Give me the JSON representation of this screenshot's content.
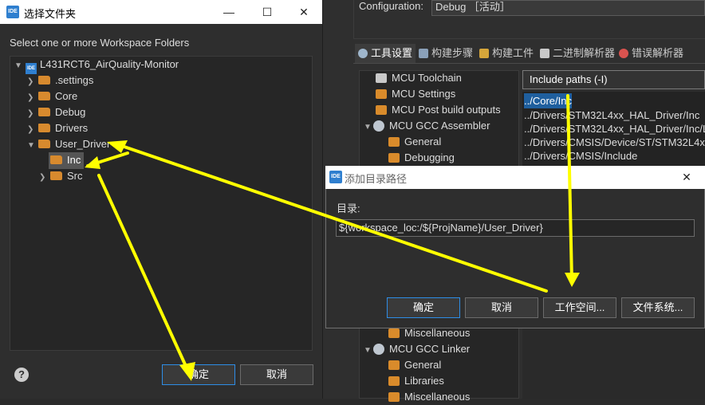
{
  "background_window": {
    "config_label": "Configuration:",
    "config_value": "Debug ［活动］",
    "tabs": [
      {
        "label": "工具设置",
        "icon": "gear-icon",
        "active": true
      },
      {
        "label": "构建步骤",
        "icon": "build-steps-icon",
        "active": false
      },
      {
        "label": "构建工件",
        "icon": "trophy-icon",
        "active": false
      },
      {
        "label": "二进制解析器",
        "icon": "binary-icon",
        "active": false
      },
      {
        "label": "错误解析器",
        "icon": "error-icon",
        "active": false
      }
    ],
    "tree": [
      {
        "label": "MCU Toolchain",
        "icon": "toolchain-icon",
        "indent": 0
      },
      {
        "label": "MCU Settings",
        "icon": "settings-icon",
        "indent": 0
      },
      {
        "label": "MCU Post build outputs",
        "icon": "settings-icon",
        "indent": 0
      },
      {
        "label": "MCU GCC Assembler",
        "icon": "gear-icon",
        "indent": 0,
        "expanded": true
      },
      {
        "label": "General",
        "icon": "settings-icon",
        "indent": 1
      },
      {
        "label": "Debugging",
        "icon": "settings-icon",
        "indent": 1
      },
      {
        "label": "Miscellaneous",
        "icon": "settings-icon",
        "indent": 1
      },
      {
        "label": "MCU GCC Linker",
        "icon": "gear-icon",
        "indent": 0,
        "expanded": true
      },
      {
        "label": "General",
        "icon": "settings-icon",
        "indent": 1
      },
      {
        "label": "Libraries",
        "icon": "settings-icon",
        "indent": 1
      },
      {
        "label": "Miscellaneous",
        "icon": "settings-icon",
        "indent": 1
      }
    ],
    "include_select": "Include paths (-I)",
    "include_paths": [
      "../Core/Inc",
      "../Drivers/STM32L4xx_HAL_Driver/Inc",
      "../Drivers/STM32L4xx_HAL_Driver/Inc/Le",
      "../Drivers/CMSIS/Device/ST/STM32L4xx",
      "../Drivers/CMSIS/Include"
    ]
  },
  "folder_dialog": {
    "title": "选择文件夹",
    "app_icon": "IDE",
    "subtitle": "Select one or more Workspace Folders",
    "tree": [
      {
        "label": "L431RCT6_AirQuality-Monitor",
        "type": "project",
        "expanded": true
      },
      {
        "label": ".settings",
        "type": "folder",
        "expanded": false
      },
      {
        "label": "Core",
        "type": "folder",
        "expanded": false
      },
      {
        "label": "Debug",
        "type": "folder",
        "expanded": false
      },
      {
        "label": "Drivers",
        "type": "folder",
        "expanded": false
      },
      {
        "label": "User_Driver",
        "type": "folder",
        "expanded": true
      },
      {
        "label": "Inc",
        "type": "folder",
        "selected": true
      },
      {
        "label": "Src",
        "type": "folder",
        "expanded": false
      }
    ],
    "ok": "确定",
    "cancel": "取消",
    "help": "?"
  },
  "path_dialog": {
    "title": "添加目录路径",
    "app_icon": "IDE",
    "label": "目录:",
    "value": "${workspace_loc:/${ProjName}/User_Driver}",
    "ok": "确定",
    "cancel": "取消",
    "workspace": "工作空间...",
    "filesystem": "文件系统..."
  },
  "colors": {
    "accent_blue": "#2e8de6",
    "folder_orange": "#d78a2e",
    "annotation_yellow": "#ffff00",
    "selection": "#1f5f9e"
  }
}
